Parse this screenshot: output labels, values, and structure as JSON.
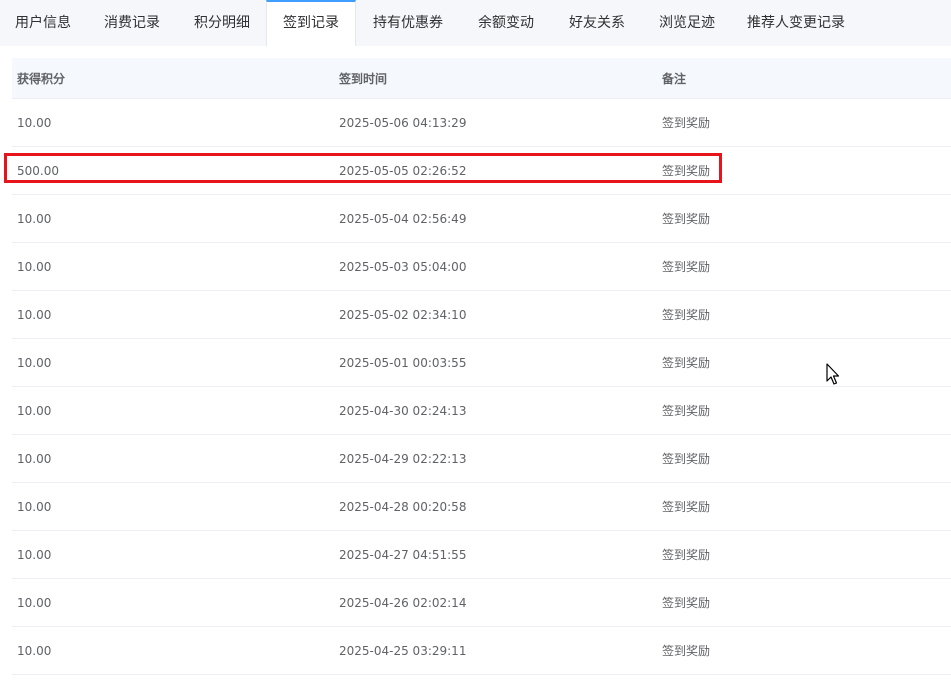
{
  "tabs": [
    {
      "label": "用户信息",
      "active": false
    },
    {
      "label": "消费记录",
      "active": false
    },
    {
      "label": "积分明细",
      "active": false
    },
    {
      "label": "签到记录",
      "active": true
    },
    {
      "label": "持有优惠券",
      "active": false
    },
    {
      "label": "余额变动",
      "active": false
    },
    {
      "label": "好友关系",
      "active": false
    },
    {
      "label": "浏览足迹",
      "active": false
    },
    {
      "label": "推荐人变更记录",
      "active": false
    }
  ],
  "table": {
    "headers": [
      "获得积分",
      "签到时间",
      "备注"
    ],
    "rows": [
      [
        "10.00",
        "2025-05-06 04:13:29",
        "签到奖励"
      ],
      [
        "500.00",
        "2025-05-05 02:26:52",
        "签到奖励"
      ],
      [
        "10.00",
        "2025-05-04 02:56:49",
        "签到奖励"
      ],
      [
        "10.00",
        "2025-05-03 05:04:00",
        "签到奖励"
      ],
      [
        "10.00",
        "2025-05-02 02:34:10",
        "签到奖励"
      ],
      [
        "10.00",
        "2025-05-01 00:03:55",
        "签到奖励"
      ],
      [
        "10.00",
        "2025-04-30 02:24:13",
        "签到奖励"
      ],
      [
        "10.00",
        "2025-04-29 02:22:13",
        "签到奖励"
      ],
      [
        "10.00",
        "2025-04-28 00:20:58",
        "签到奖励"
      ],
      [
        "10.00",
        "2025-04-27 04:51:55",
        "签到奖励"
      ],
      [
        "10.00",
        "2025-04-26 02:02:14",
        "签到奖励"
      ],
      [
        "10.00",
        "2025-04-25 03:29:11",
        "签到奖励"
      ]
    ]
  },
  "colors": {
    "active_tab_accent": "#409eff",
    "highlight_border": "#e8141b"
  }
}
